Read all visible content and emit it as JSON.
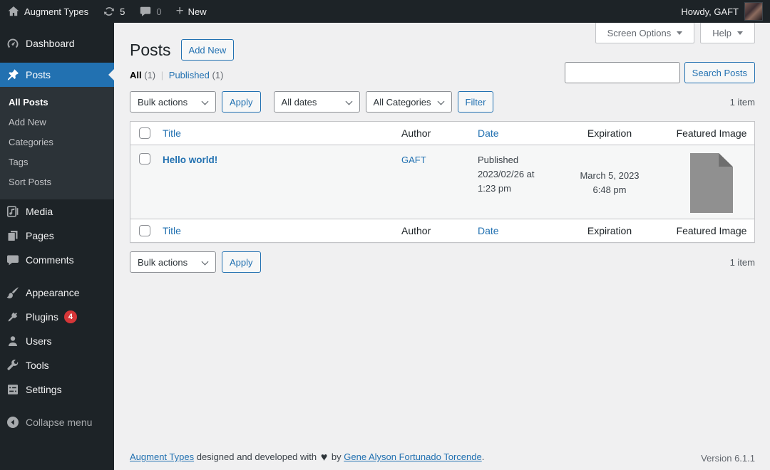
{
  "colors": {
    "accent": "#2271b1",
    "admin_bar_bg": "#1d2327",
    "submenu_bg": "#2c3338",
    "content_bg": "#f0f0f1",
    "badge_red": "#d63638",
    "link_blue": "#2271b1"
  },
  "admin_bar": {
    "site_name": "Augment Types",
    "update_count": "5",
    "comment_count": "0",
    "new_label": "New",
    "howdy_text": "Howdy, GAFT"
  },
  "sidebar": {
    "items": [
      {
        "label": "Dashboard"
      },
      {
        "label": "Posts"
      },
      {
        "label": "Media"
      },
      {
        "label": "Pages"
      },
      {
        "label": "Comments"
      },
      {
        "label": "Appearance"
      },
      {
        "label": "Plugins",
        "badge": "4"
      },
      {
        "label": "Users"
      },
      {
        "label": "Tools"
      },
      {
        "label": "Settings"
      }
    ],
    "posts_submenu": [
      {
        "label": "All Posts"
      },
      {
        "label": "Add New"
      },
      {
        "label": "Categories"
      },
      {
        "label": "Tags"
      },
      {
        "label": "Sort Posts"
      }
    ],
    "collapse_label": "Collapse menu"
  },
  "content": {
    "page_title": "Posts",
    "add_new_label": "Add New",
    "screen_options_label": "Screen Options",
    "help_label": "Help",
    "views": {
      "all": "All",
      "all_count": "(1)",
      "separator": "|",
      "published": "Published",
      "published_count": "(1)"
    },
    "search": {
      "value": "",
      "button": "Search Posts"
    },
    "toolbar": {
      "bulk_actions": "Bulk actions",
      "apply": "Apply",
      "all_dates": "All dates",
      "all_categories": "All Categories",
      "filter": "Filter",
      "item_count": "1 item"
    },
    "table": {
      "columns": [
        {
          "label": "Title"
        },
        {
          "label": "Author"
        },
        {
          "label": "Date"
        },
        {
          "label": "Expiration"
        },
        {
          "label": "Featured Image"
        }
      ],
      "rows": [
        {
          "title": "Hello world!",
          "author": "GAFT",
          "status": "Published",
          "date_line1": "2023/02/26 at",
          "date_line2": "1:23 pm",
          "expiration_line1": "March 5, 2023",
          "expiration_line2": "6:48 pm"
        }
      ]
    }
  },
  "footer": {
    "credit_link": "Augment Types",
    "credit_text": "designed and developed with",
    "heart": "♥",
    "by_text": "by",
    "author_link": "Gene Alyson Fortunado Torcende",
    "period": ".",
    "version": "Version 6.1.1"
  }
}
